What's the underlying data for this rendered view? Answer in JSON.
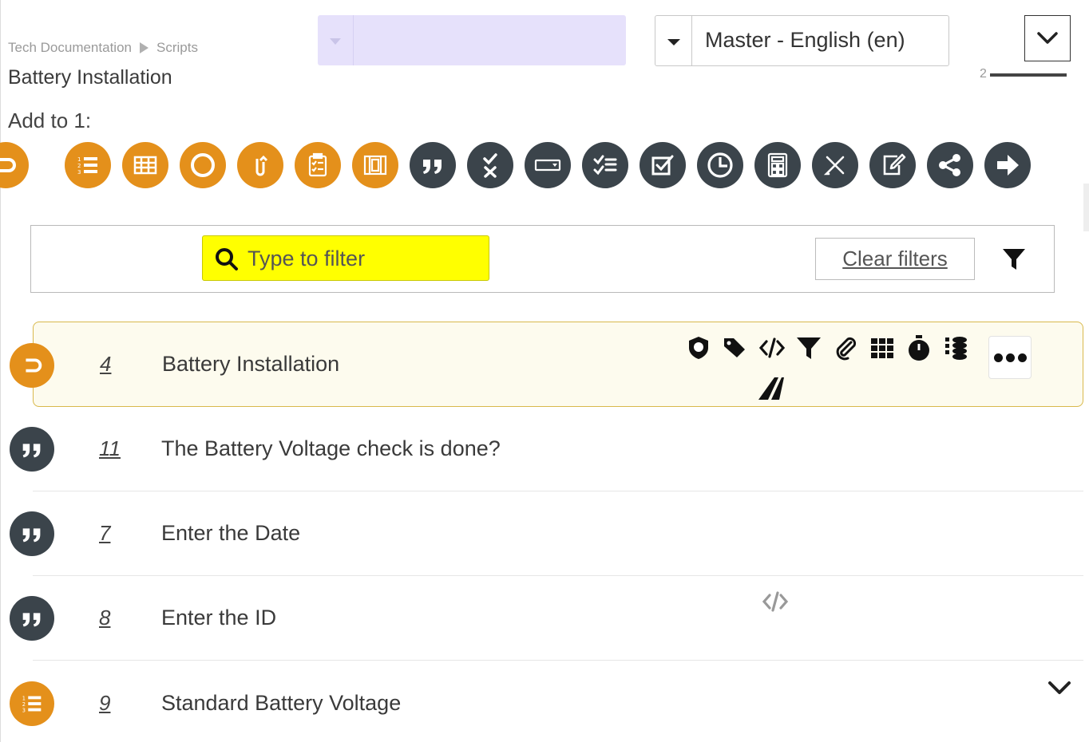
{
  "breadcrumb": {
    "root": "Tech Documentation",
    "current": "Scripts"
  },
  "page_title": "Battery Installation",
  "language_select": {
    "value": "Master - English (en)"
  },
  "zoom": {
    "value": "2"
  },
  "add_to_label": "Add to 1:",
  "palette": [
    {
      "name": "start-node-icon",
      "color": "#e4901b"
    },
    {
      "name": "numbered-list-icon",
      "color": "#e4901b"
    },
    {
      "name": "table-icon",
      "color": "#e4901b"
    },
    {
      "name": "circle-icon",
      "color": "#e4901b"
    },
    {
      "name": "loop-icon",
      "color": "#e4901b"
    },
    {
      "name": "clipboard-checklist-icon",
      "color": "#e4901b"
    },
    {
      "name": "film-icon",
      "color": "#e4901b"
    },
    {
      "name": "quote-icon",
      "color": "#3b444b"
    },
    {
      "name": "check-cross-icon",
      "color": "#3b444b"
    },
    {
      "name": "dropdown-field-icon",
      "color": "#3b444b"
    },
    {
      "name": "checklist-icon",
      "color": "#3b444b"
    },
    {
      "name": "checkbox-icon",
      "color": "#3b444b"
    },
    {
      "name": "clock-icon",
      "color": "#3b444b"
    },
    {
      "name": "calculator-icon",
      "color": "#3b444b"
    },
    {
      "name": "pencil-ruler-icon",
      "color": "#3b444b"
    },
    {
      "name": "edit-form-icon",
      "color": "#3b444b"
    },
    {
      "name": "share-icon",
      "color": "#3b444b"
    },
    {
      "name": "arrow-right-icon",
      "color": "#3b444b"
    }
  ],
  "filter": {
    "placeholder": "Type to filter",
    "clear_label": "Clear filters"
  },
  "rows": [
    {
      "num": "4",
      "text": "Battery Installation",
      "icon": "start-node-icon",
      "selected": true
    },
    {
      "num": "11",
      "text": "The Battery Voltage check is done?",
      "icon": "quote-icon"
    },
    {
      "num": "7",
      "text": "Enter the Date",
      "icon": "quote-icon"
    },
    {
      "num": "8",
      "text": "Enter the ID",
      "icon": "quote-icon"
    },
    {
      "num": "9",
      "text": "Standard Battery Voltage",
      "icon": "numbered-list-icon"
    }
  ],
  "colors": {
    "accent_orange": "#e4901b",
    "dark_icon": "#3b444b",
    "search_highlight": "#ffff00",
    "selected_row": "#fdfbee"
  }
}
